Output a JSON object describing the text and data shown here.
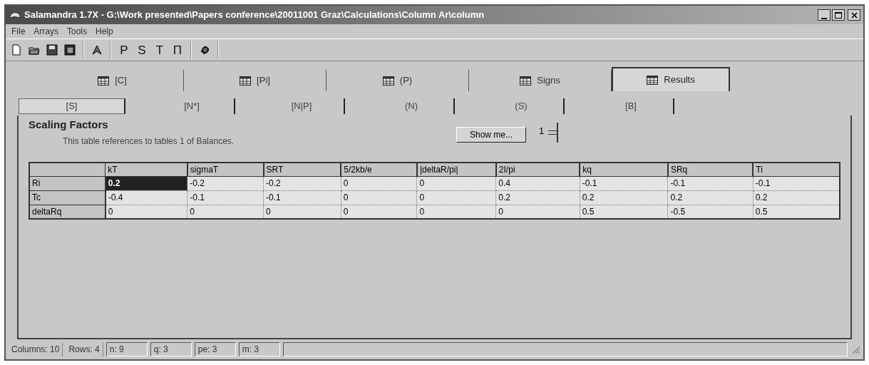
{
  "window": {
    "title": "Salamandra 1.7X - G:\\Work presented\\Papers conference\\20011001 Graz\\Calculations\\Column Ar\\column"
  },
  "menu": [
    "File",
    "Arrays",
    "Tools",
    "Help"
  ],
  "toolbar": [
    {
      "kind": "icon"
    },
    {
      "kind": "icon"
    },
    {
      "kind": "icon"
    },
    {
      "kind": "icon"
    },
    {
      "kind": "sep"
    },
    {
      "kind": "icon"
    },
    {
      "kind": "sep"
    },
    {
      "kind": "text",
      "label": "P"
    },
    {
      "kind": "text",
      "label": "S"
    },
    {
      "kind": "text",
      "label": "T"
    },
    {
      "kind": "text",
      "label": "Π"
    },
    {
      "kind": "sep"
    },
    {
      "kind": "icon"
    },
    {
      "kind": "sep"
    }
  ],
  "tabs": [
    {
      "label": "[C]",
      "selected": false
    },
    {
      "label": "[Pi]",
      "selected": false
    },
    {
      "label": "(P)",
      "selected": false
    },
    {
      "label": "Signs",
      "selected": false
    },
    {
      "label": "Results",
      "selected": true
    }
  ],
  "subtabs": [
    {
      "label": "[S]",
      "selected": true
    },
    {
      "label": "[N*]",
      "selected": false
    },
    {
      "label": "[N|P]",
      "selected": false
    },
    {
      "label": "(N)",
      "selected": false
    },
    {
      "label": "(S)",
      "selected": false
    },
    {
      "label": "[B]",
      "selected": false
    }
  ],
  "panel": {
    "heading": "Scaling Factors",
    "description": "This table references to tables 1 of Balances.",
    "show_button": "Show me...",
    "spinner_value": "1"
  },
  "table": {
    "columns": [
      "kT",
      "sigmaT",
      "SRT",
      "5/2kb/e",
      "|deltaR/pi|",
      "2I/pi",
      "kq",
      "SRq",
      "Ti"
    ],
    "rows": [
      {
        "label": "Ri",
        "cells": [
          "0.2",
          "-0.2",
          "-0.2",
          "0",
          "0",
          "0.4",
          "-0.1",
          "-0.1",
          "-0.1"
        ],
        "selected": true
      },
      {
        "label": "Tc",
        "cells": [
          "-0.4",
          "-0.1",
          "-0.1",
          "0",
          "0",
          "0.2",
          "0.2",
          "0.2",
          "0.2"
        ],
        "selected": false
      },
      {
        "label": "deltaRq",
        "cells": [
          "0",
          "0",
          "0",
          "0",
          "0",
          "0",
          "0.5",
          "-0.5",
          "0.5"
        ],
        "selected": false
      }
    ]
  },
  "status_bar": [
    {
      "text": "Columns: 10",
      "kind": "flat"
    },
    {
      "text": "Rows: 4",
      "kind": "flat"
    },
    {
      "text": "n: 9",
      "kind": "sunken"
    },
    {
      "text": "q: 3",
      "kind": "sunken"
    },
    {
      "text": "pe: 3",
      "kind": "sunken"
    },
    {
      "text": "m: 3",
      "kind": "sunken"
    }
  ]
}
